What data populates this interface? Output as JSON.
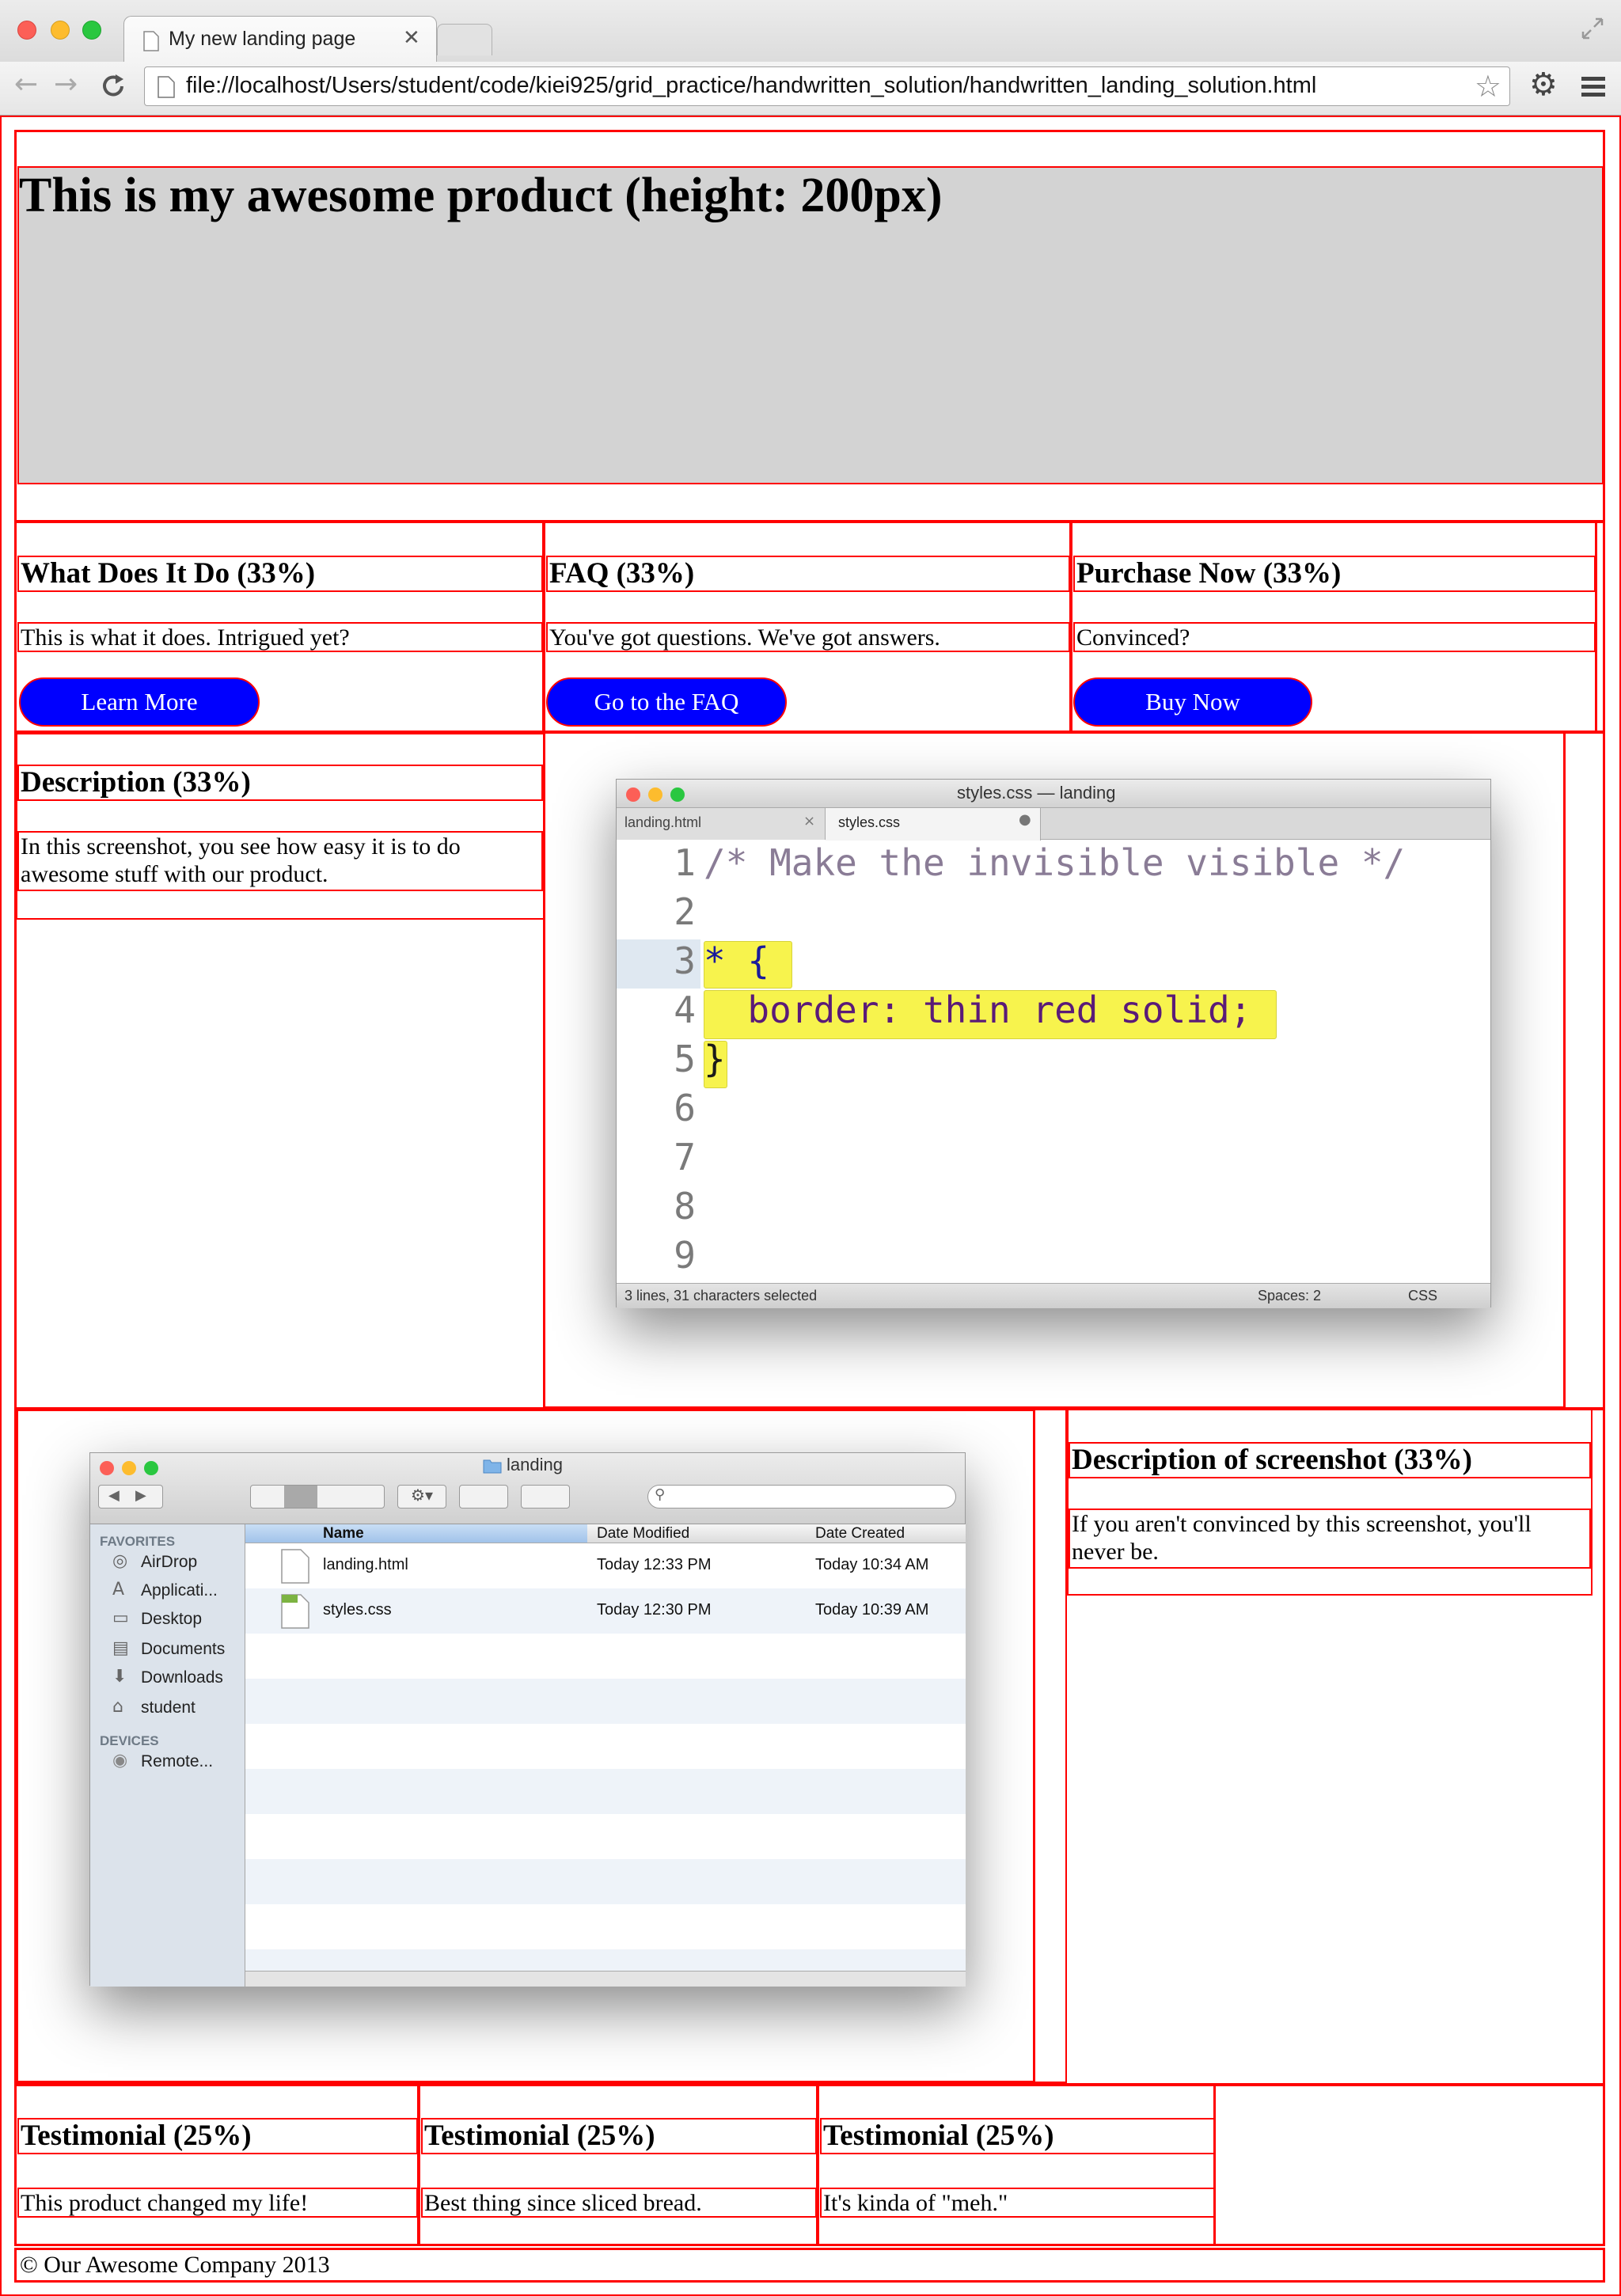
{
  "browser": {
    "tab_title": "My new landing page",
    "url": "file://localhost/Users/student/code/kiei925/grid_practice/handwritten_solution/handwritten_landing_solution.html"
  },
  "hero": {
    "title": "This is my awesome product (height: 200px)"
  },
  "features": [
    {
      "heading": "What Does It Do (33%)",
      "text": "This is what it does. Intrigued yet?",
      "button": "Learn More"
    },
    {
      "heading": "FAQ (33%)",
      "text": "You've got questions. We've got answers.",
      "button": "Go to the FAQ"
    },
    {
      "heading": "Purchase Now (33%)",
      "text": "Convinced?",
      "button": "Buy Now"
    }
  ],
  "description": {
    "heading": "Description (33%)",
    "text": "In this screenshot, you see how easy it is to do awesome stuff with our product."
  },
  "editor": {
    "window_title": "styles.css — landing",
    "tabs": [
      "landing.html",
      "styles.css"
    ],
    "lines": [
      {
        "num": "1",
        "code": "/* Make the invisible visible */"
      },
      {
        "num": "2",
        "code": ""
      },
      {
        "num": "3",
        "code": "* {"
      },
      {
        "num": "4",
        "code": "  border: thin red solid;"
      },
      {
        "num": "5",
        "code": "}"
      },
      {
        "num": "6",
        "code": ""
      },
      {
        "num": "7",
        "code": ""
      },
      {
        "num": "8",
        "code": ""
      },
      {
        "num": "9",
        "code": ""
      }
    ],
    "status_left": "3 lines, 31 characters selected",
    "status_spaces": "Spaces: 2",
    "status_syntax": "CSS"
  },
  "finder": {
    "window_title": "landing",
    "sidebar_favorites_label": "FAVORITES",
    "sidebar_favorites": [
      "AirDrop",
      "Applicati...",
      "Desktop",
      "Documents",
      "Downloads",
      "student"
    ],
    "sidebar_devices_label": "DEVICES",
    "sidebar_devices": [
      "Remote..."
    ],
    "columns": [
      "Name",
      "Date Modified",
      "Date Created"
    ],
    "rows": [
      {
        "name": "landing.html",
        "modified": "Today 12:33 PM",
        "created": "Today 10:34 AM"
      },
      {
        "name": "styles.css",
        "modified": "Today 12:30 PM",
        "created": "Today 10:39 AM"
      }
    ]
  },
  "screenshot_desc": {
    "heading": "Description of screenshot (33%)",
    "text": "If you aren't convinced by this screenshot, you'll never be."
  },
  "testimonials": [
    {
      "heading": "Testimonial (25%)",
      "text": "This product changed my life!"
    },
    {
      "heading": "Testimonial (25%)",
      "text": "Best thing since sliced bread."
    },
    {
      "heading": "Testimonial (25%)",
      "text": "It's kinda of \"meh.\""
    }
  ],
  "footer": {
    "text": "© Our Awesome Company 2013"
  }
}
